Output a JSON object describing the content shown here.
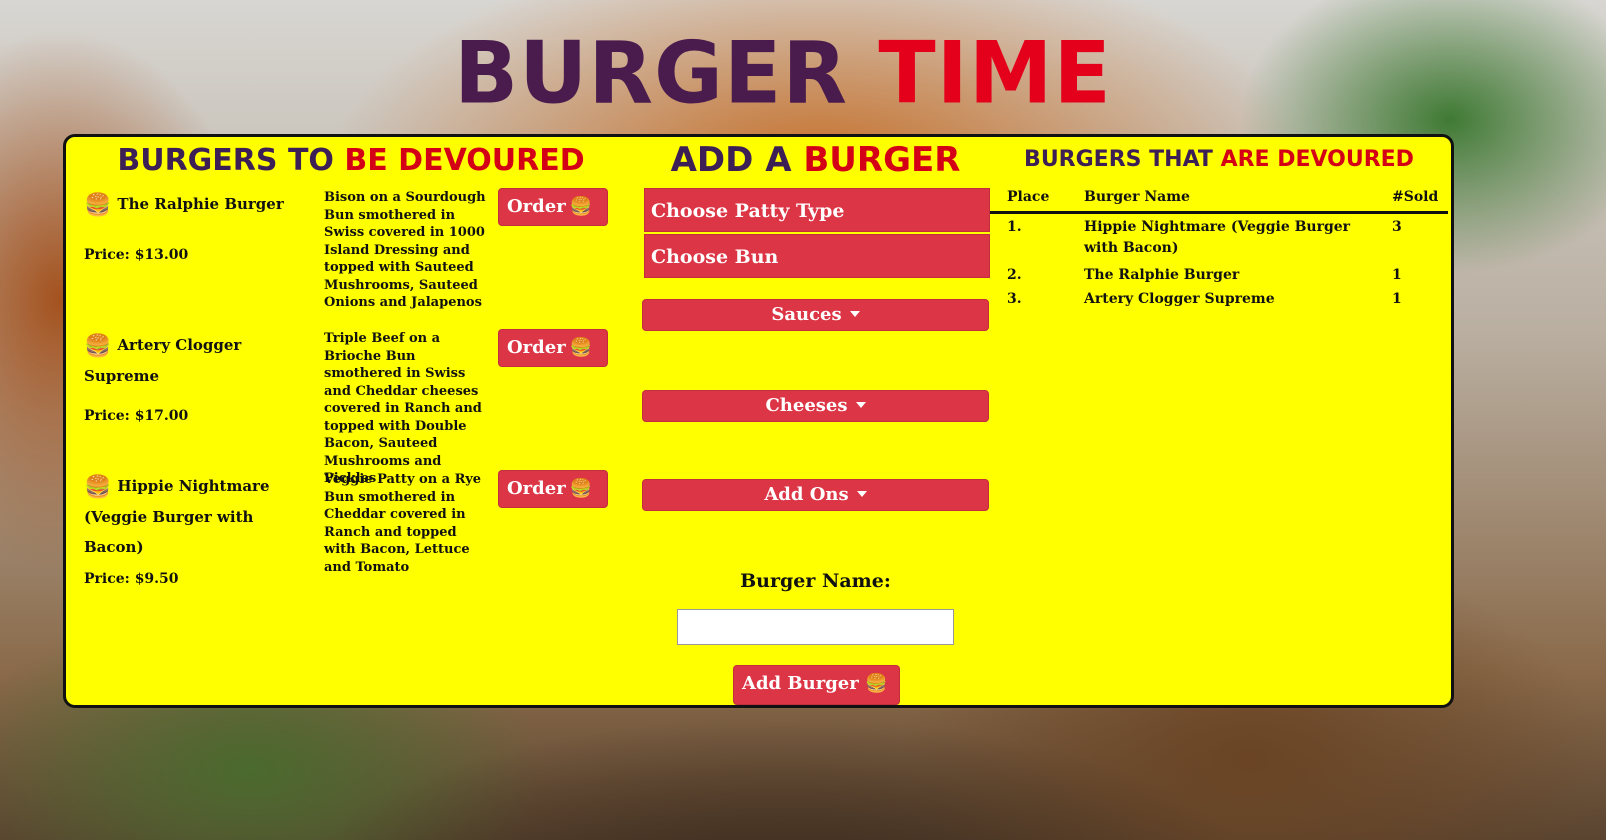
{
  "header": {
    "title_part1": "BURGER",
    "title_part2": "TIME"
  },
  "menu": {
    "heading_a": "BURGERS TO ",
    "heading_b": "BE DEVOURED",
    "items": [
      {
        "name": "The Ralphie Burger",
        "price": "Price: $13.00",
        "description": "Bison on a Sourdough Bun smothered in Swiss covered in 1000 Island Dressing and topped with Sauteed Mushrooms, Sauteed Onions and Jalapenos",
        "order_label": "Order"
      },
      {
        "name": "Artery Clogger Supreme",
        "price": "Price: $17.00",
        "description": "Triple Beef on a Brioche Bun smothered in Swiss and Cheddar cheeses covered in Ranch and topped with Double Bacon, Sauteed Mushrooms and Pickles",
        "order_label": "Order"
      },
      {
        "name": "Hippie Nightmare (Veggie Burger with Bacon)",
        "price": "Price: $9.50",
        "description": "Veggie Patty on a Rye Bun smothered in Cheddar covered in Ranch and topped with Bacon, Lettuce and Tomato",
        "order_label": "Order"
      }
    ]
  },
  "add_form": {
    "heading_a": "ADD A ",
    "heading_b": "BURGER",
    "patty_select": "Choose Patty Type",
    "bun_select": "Choose Bun",
    "sauces_label": "Sauces",
    "cheeses_label": "Cheeses",
    "addons_label": "Add Ons",
    "name_label": "Burger Name:",
    "name_value": "",
    "submit_label": "Add Burger"
  },
  "devoured": {
    "heading_a": "BURGERS THAT ",
    "heading_b": "ARE DEVOURED",
    "columns": [
      "Place",
      "Burger Name",
      "#Sold"
    ],
    "rows": [
      {
        "place": "1.",
        "name": "Hippie Nightmare (Veggie Burger with Bacon)",
        "sold": "3"
      },
      {
        "place": "2.",
        "name": "The Ralphie Burger",
        "sold": "1"
      },
      {
        "place": "3.",
        "name": "Artery Clogger Supreme",
        "sold": "1"
      }
    ]
  },
  "icons": {
    "burger": "hamburger-icon",
    "caret": "caret-down-icon"
  },
  "colors": {
    "panel": "#ffff00",
    "button": "#dc3545",
    "title_dark": "#4a1c4e",
    "title_red": "#e4001b"
  }
}
